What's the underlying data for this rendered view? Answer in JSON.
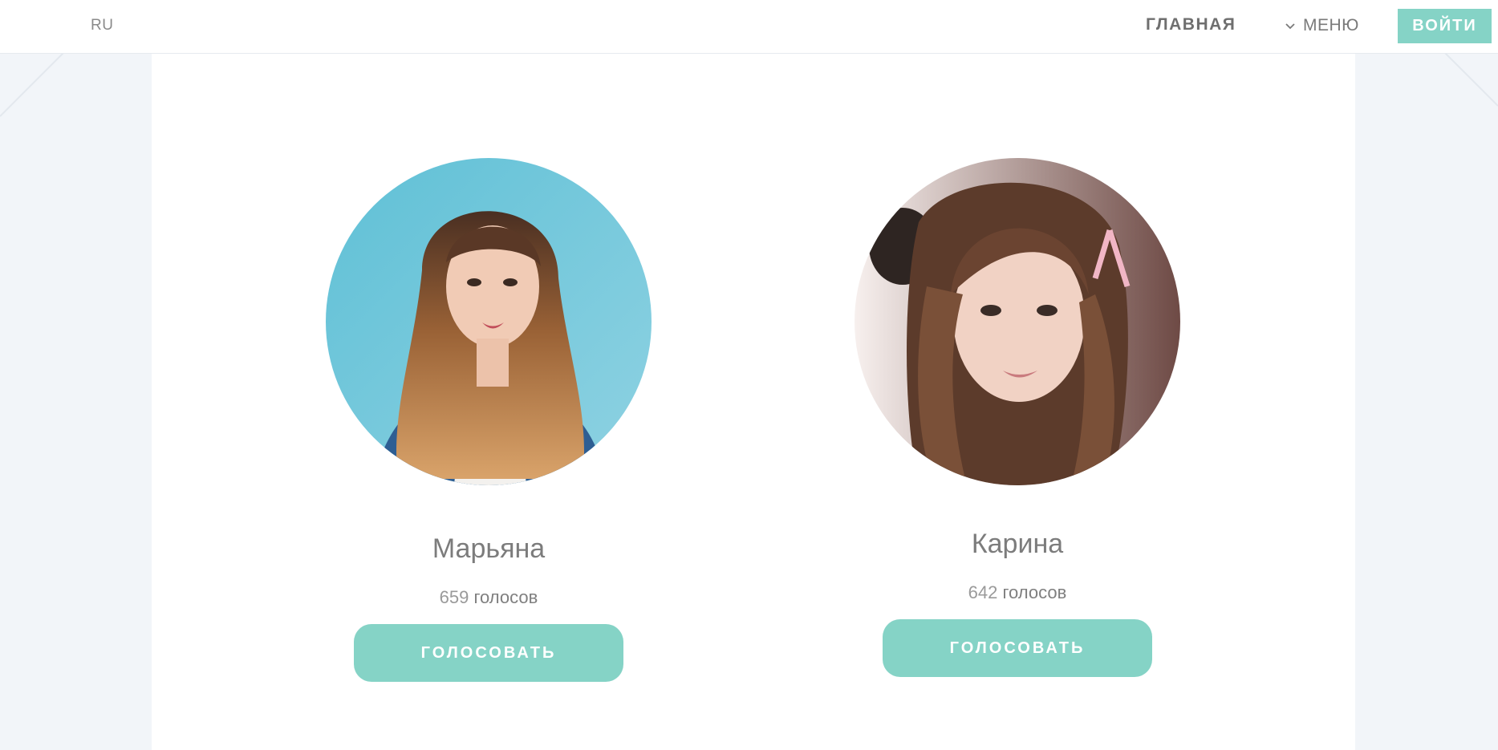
{
  "header": {
    "language": "RU",
    "nav_home": "ГЛАВНАЯ",
    "nav_menu": "МЕНЮ",
    "login_button": "ВОЙТИ"
  },
  "candidates": [
    {
      "name": "Марьяна",
      "votes_count": "659",
      "votes_label": "голосов",
      "vote_button": "ГОЛОСОВАТЬ"
    },
    {
      "name": "Карина",
      "votes_count": "642",
      "votes_label": "голосов",
      "vote_button": "ГОЛОСОВАТЬ"
    }
  ],
  "colors": {
    "accent": "#85d3c6",
    "page_background": "#f2f5f9",
    "panel_background": "#ffffff",
    "text_gray": "#7c7c7c"
  },
  "icons": {
    "menu_toggle": "chevron-down-icon"
  }
}
